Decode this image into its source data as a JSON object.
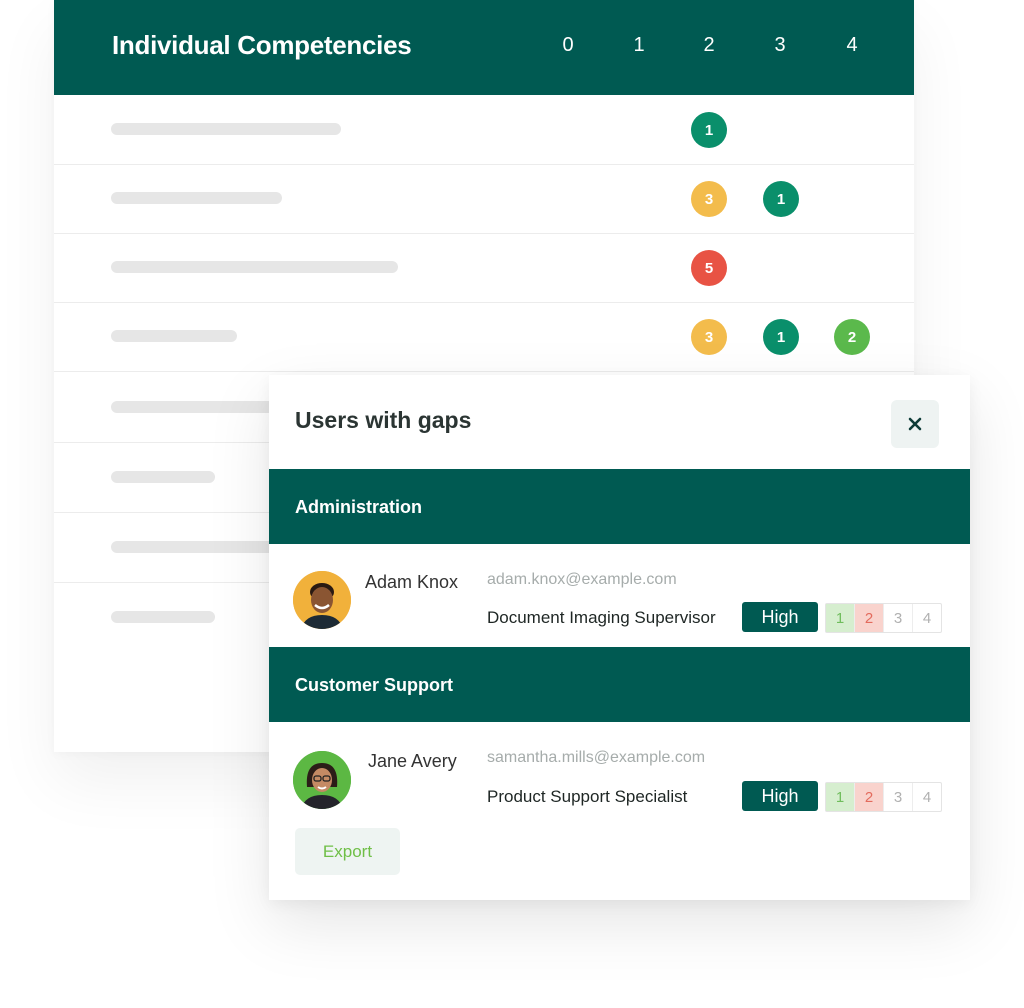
{
  "competencies": {
    "title": "Individual Competencies",
    "levels": [
      "0",
      "1",
      "2",
      "3",
      "4"
    ],
    "rows": [
      {
        "bubbles": [
          {
            "level": "2",
            "count": "1",
            "color": "#0a8f6b"
          }
        ]
      },
      {
        "bubbles": [
          {
            "level": "2",
            "count": "3",
            "color": "#f3bc4c"
          },
          {
            "level": "3",
            "count": "1",
            "color": "#0a8f6b"
          }
        ]
      },
      {
        "bubbles": [
          {
            "level": "2",
            "count": "5",
            "color": "#e85344"
          }
        ]
      },
      {
        "bubbles": [
          {
            "level": "2",
            "count": "3",
            "color": "#f3bc4c"
          },
          {
            "level": "3",
            "count": "1",
            "color": "#0a8f6b"
          },
          {
            "level": "4",
            "count": "2",
            "color": "#5bb94c"
          }
        ]
      }
    ]
  },
  "gaps_panel": {
    "title": "Users with gaps",
    "close_icon": "close-icon",
    "groups": [
      {
        "name": "Administration",
        "users": [
          {
            "name": "Adam Knox",
            "email": "adam.knox@example.com",
            "role": "Document Imaging Supervisor",
            "priority": "High",
            "scale": [
              "1",
              "2",
              "3",
              "4"
            ]
          }
        ]
      },
      {
        "name": "Customer Support",
        "users": [
          {
            "name": "Jane Avery",
            "email": "samantha.mills@example.com",
            "role": "Product Support Specialist",
            "priority": "High",
            "scale": [
              "1",
              "2",
              "3",
              "4"
            ]
          }
        ]
      }
    ],
    "export_label": "Export"
  },
  "colors": {
    "brand_teal": "#005a52",
    "accent_green": "#6fbf47",
    "gap_red": "#e36b5d"
  }
}
